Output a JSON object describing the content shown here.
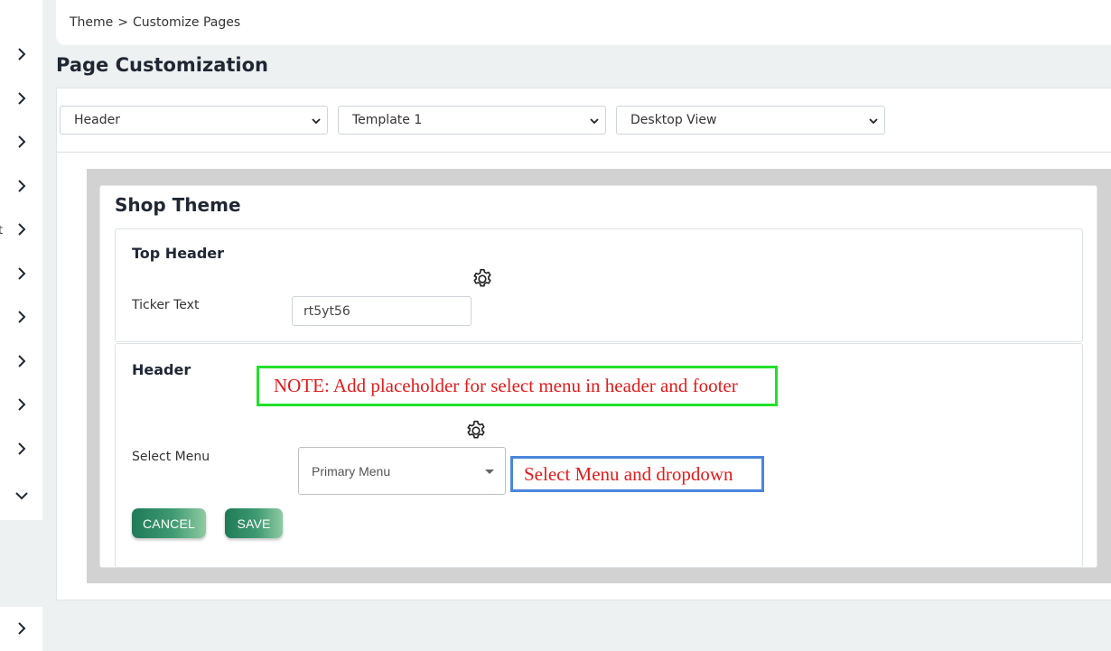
{
  "breadcrumb": {
    "parent": "Theme",
    "separator": ">",
    "current": "Customize Pages"
  },
  "page_title": "Page Customization",
  "filters": {
    "section_select": "Header",
    "template_select": "Template 1",
    "view_select": "Desktop View"
  },
  "sidebar": {
    "stray_text": "t",
    "icons": [
      "chevron-right-icon",
      "chevron-right-icon",
      "chevron-right-icon",
      "chevron-right-icon",
      "chevron-right-icon",
      "chevron-right-icon",
      "chevron-right-icon",
      "chevron-right-icon",
      "chevron-right-icon",
      "chevron-right-icon",
      "chevron-down-icon",
      "chevron-right-icon"
    ]
  },
  "theme": {
    "title": "Shop Theme",
    "top_header": {
      "title": "Top Header",
      "ticker_label": "Ticker Text",
      "ticker_value": "rt5yt56",
      "settings_icon": "gear-icon"
    },
    "header": {
      "title": "Header",
      "select_menu_label": "Select Menu",
      "select_menu_value": "Primary Menu",
      "settings_icon": "gear-icon"
    },
    "buttons": {
      "cancel": "CANCEL",
      "save": "SAVE"
    }
  },
  "annotations": {
    "note": "NOTE: Add placeholder for select menu in header and footer",
    "select_menu_note": "Select Menu and dropdown",
    "note_border_color": "#22e02a",
    "select_note_border_color": "#4a86dc",
    "text_color": "#e21b1b"
  },
  "colors": {
    "button_gradient_start": "#1f7a58",
    "button_gradient_end": "#8fcaa3",
    "preview_frame": "#d3d2d3"
  }
}
